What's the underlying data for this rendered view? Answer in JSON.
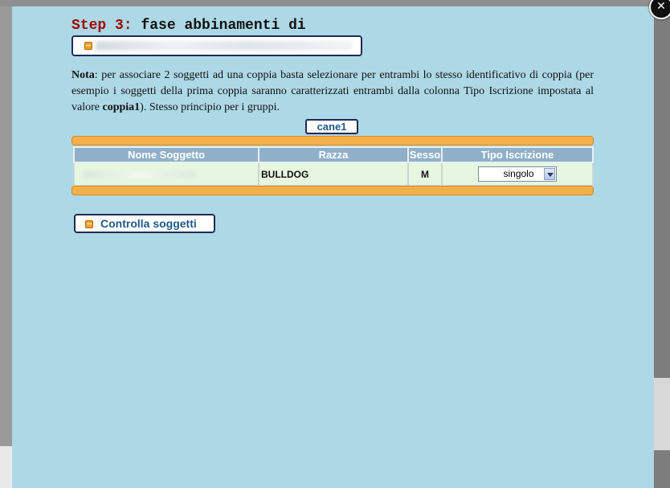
{
  "modal": {
    "close_glyph": "✕",
    "step_prefix": "Step 3:",
    "step_title": "fase abbinamenti di"
  },
  "note": {
    "label": "Nota",
    "text_part1": ": per associare 2 soggetti ad una coppia basta selezionare per entrambi lo stesso identificativo di coppia (per esempio i soggetti della prima coppia saranno caratterizzati entrambi dalla colonna Tipo Iscrizione impostata al valore ",
    "value": "coppia1",
    "text_part2": "). Stesso principio per i gruppi."
  },
  "dog_tab": "cane1",
  "table": {
    "headers": [
      "Nome Soggetto",
      "Razza",
      "Sesso",
      "Tipo Iscrizione"
    ],
    "rows": [
      {
        "razza": "BULLDOG",
        "sesso": "M",
        "tipo": "singolo"
      }
    ]
  },
  "actions": {
    "check_label": "Controlla soggetti"
  },
  "colors": {
    "modal_bg": "#add8e6",
    "accent_orange": "#f4b04a",
    "header_blue": "#8fb0c8",
    "row_green": "#e6f6e0",
    "step_red": "#a00000"
  },
  "icons": [
    "close-icon",
    "bullet-icon",
    "chevron-down-icon"
  ]
}
